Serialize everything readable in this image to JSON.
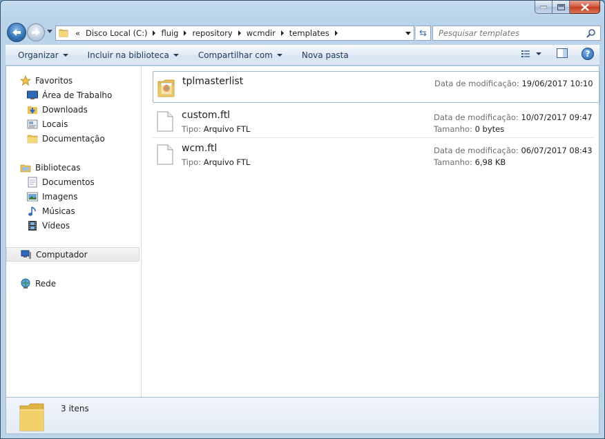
{
  "navbar": {
    "breadcrumbs": [
      "«",
      "Disco Local (C:)",
      "fluig",
      "repository",
      "wcmdir",
      "templates"
    ],
    "search_placeholder": "Pesquisar templates"
  },
  "commands": {
    "organize": "Organizar",
    "include_library": "Incluir na biblioteca",
    "share": "Compartilhar com",
    "new_folder": "Nova pasta"
  },
  "sidebar": {
    "favorites": {
      "label": "Favoritos",
      "items": [
        {
          "label": "Área de Trabalho",
          "icon": "desktop-icon"
        },
        {
          "label": "Downloads",
          "icon": "downloads-folder-icon"
        },
        {
          "label": "Locais",
          "icon": "recent-places-icon"
        },
        {
          "label": "Documentação",
          "icon": "folder-icon"
        }
      ]
    },
    "libraries": {
      "label": "Bibliotecas",
      "items": [
        {
          "label": "Documentos",
          "icon": "documents-icon"
        },
        {
          "label": "Imagens",
          "icon": "pictures-icon"
        },
        {
          "label": "Músicas",
          "icon": "music-icon"
        },
        {
          "label": "Vídeos",
          "icon": "videos-icon"
        }
      ]
    },
    "computer": "Computador",
    "network": "Rede"
  },
  "files": [
    {
      "name": "tplmasterlist",
      "kind": "folder",
      "date_label": "Data de modificação:",
      "date": "19/06/2017 10:10"
    },
    {
      "name": "custom.ftl",
      "kind": "file",
      "type_label": "Tipo:",
      "type": "Arquivo FTL",
      "date_label": "Data de modificação:",
      "date": "10/07/2017 09:47",
      "size_label": "Tamanho:",
      "size": "0 bytes"
    },
    {
      "name": "wcm.ftl",
      "kind": "file",
      "type_label": "Tipo:",
      "type": "Arquivo FTL",
      "date_label": "Data de modificação:",
      "date": "06/07/2017 08:43",
      "size_label": "Tamanho:",
      "size": "6,98 KB"
    }
  ],
  "details": {
    "count": "3 itens"
  }
}
